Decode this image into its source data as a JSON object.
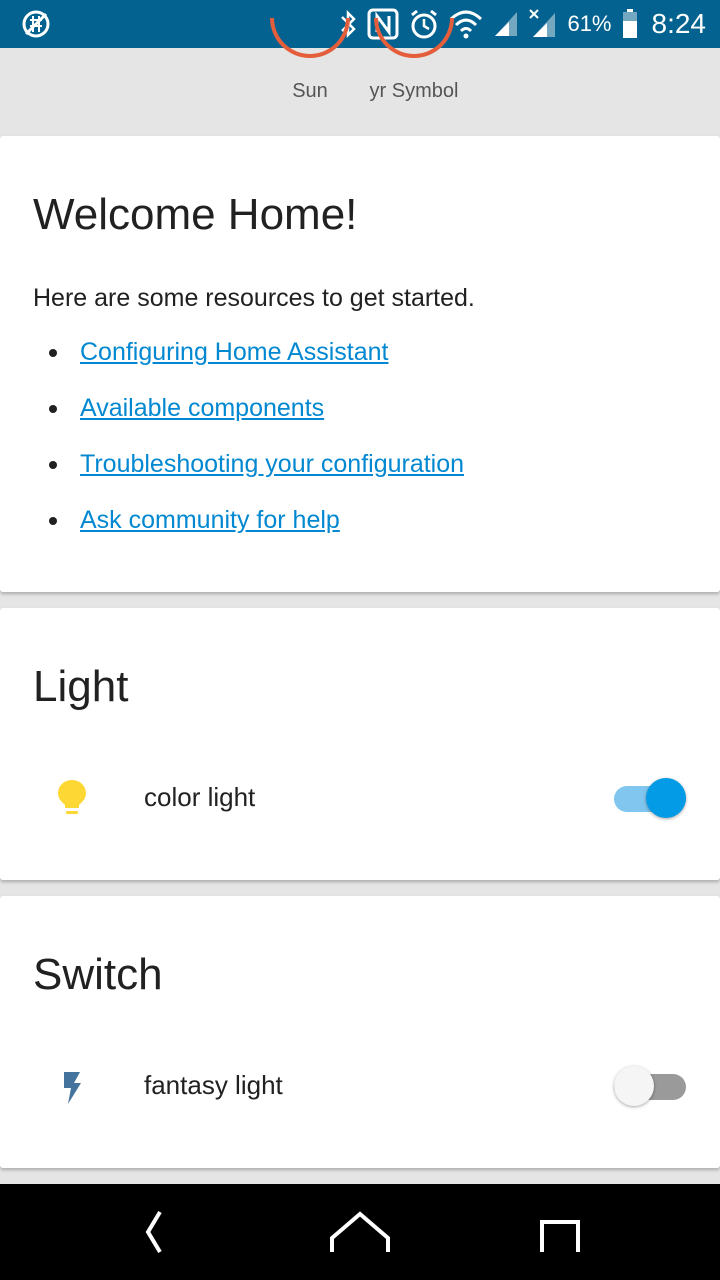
{
  "status_bar": {
    "battery_text": "61%",
    "time": "8:24",
    "icons": [
      "no-sim-icon",
      "bluetooth-icon",
      "nfc-icon",
      "alarm-icon",
      "wifi-icon",
      "signal-icon",
      "signal-x-icon",
      "battery-icon"
    ],
    "background": "#03628f"
  },
  "badges": [
    {
      "label": "Sun",
      "ring_color": "#e45e3c"
    },
    {
      "label": "yr Symbol",
      "ring_color": "#e45e3c"
    }
  ],
  "welcome_card": {
    "title": "Welcome Home!",
    "intro": "Here are some resources to get started.",
    "links": [
      {
        "label": "Configuring Home Assistant"
      },
      {
        "label": "Available components"
      },
      {
        "label": "Troubleshooting your configuration"
      },
      {
        "label": "Ask community for help"
      }
    ],
    "link_color": "#0288d1"
  },
  "light_card": {
    "title": "Light",
    "entities": [
      {
        "name": "color light",
        "icon": "lightbulb-icon",
        "icon_color": "#fdd835",
        "state": "on"
      }
    ]
  },
  "switch_card": {
    "title": "Switch",
    "entities": [
      {
        "name": "fantasy light",
        "icon": "flash-icon",
        "icon_color": "#44739e",
        "state": "off"
      }
    ]
  },
  "nav_bar": {
    "buttons": [
      "back-icon",
      "home-icon",
      "recents-icon"
    ]
  }
}
